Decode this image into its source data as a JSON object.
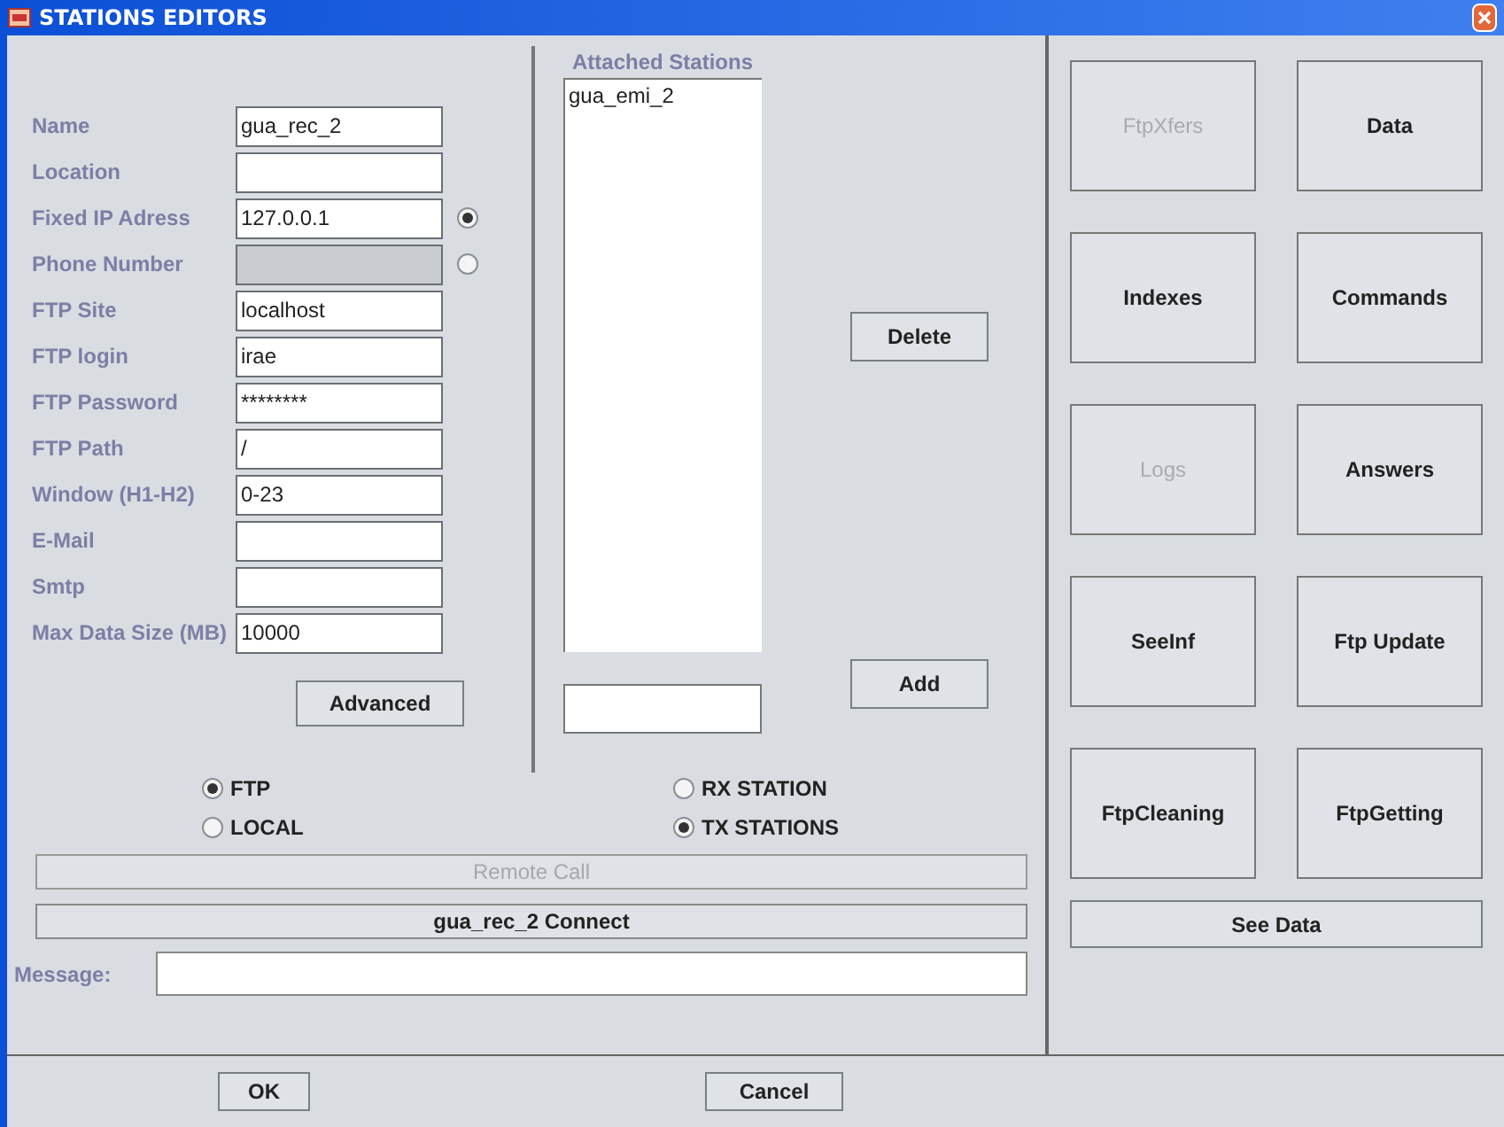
{
  "window": {
    "title": "STATIONS EDITORS"
  },
  "fields": [
    {
      "label": "Name",
      "value": "gua_rec_2",
      "disabled": false
    },
    {
      "label": "Location",
      "disabled": false
    },
    {
      "label": "Fixed IP Adress",
      "value": "127.0.0.1",
      "disabled": false,
      "radio": {
        "selected": true
      }
    },
    {
      "label": "Phone Number",
      "disabled": true,
      "radio": {
        "selected": false
      }
    },
    {
      "label": "FTP Site",
      "value": "localhost",
      "disabled": false
    },
    {
      "label": "FTP login",
      "value": "irae",
      "disabled": false
    },
    {
      "label": "FTP Password",
      "value": "********",
      "disabled": false
    },
    {
      "label": "FTP Path",
      "value": "/",
      "disabled": false
    },
    {
      "label": "Window (H1-H2)",
      "value": "0-23",
      "disabled": false
    },
    {
      "label": "E-Mail",
      "disabled": false
    },
    {
      "label": "Smtp",
      "disabled": false
    },
    {
      "label": "Max Data Size (MB)",
      "value": "10000",
      "disabled": false
    }
  ],
  "advanced_button": "Advanced",
  "attached_stations": {
    "title": "Attached Stations",
    "items": [
      "gua_emi_2"
    ],
    "delete_button": "Delete",
    "add_button": "Add"
  },
  "mode_options": [
    {
      "label": "FTP",
      "selected": true
    },
    {
      "label": "LOCAL",
      "selected": false
    }
  ],
  "station_options": [
    {
      "label": "RX STATION",
      "selected": false
    },
    {
      "label": "TX STATIONS",
      "selected": true
    }
  ],
  "remote_call": {
    "label": "Remote Call",
    "disabled": true
  },
  "connect_button": "gua_rec_2 Connect",
  "message": {
    "label": "Message:"
  },
  "action_buttons": [
    {
      "label": "FtpXfers",
      "disabled": true
    },
    {
      "label": "Data",
      "disabled": false
    },
    {
      "label": "Indexes",
      "disabled": false
    },
    {
      "label": "Commands",
      "disabled": false
    },
    {
      "label": "Logs",
      "disabled": true
    },
    {
      "label": "Answers",
      "disabled": false
    },
    {
      "label": "SeeInf",
      "disabled": false
    },
    {
      "label": "Ftp Update",
      "disabled": false
    },
    {
      "label": "FtpCleaning",
      "disabled": false
    },
    {
      "label": "FtpGetting",
      "disabled": false
    }
  ],
  "see_data_button": "See Data",
  "dialog_buttons": [
    "OK",
    "Cancel"
  ]
}
